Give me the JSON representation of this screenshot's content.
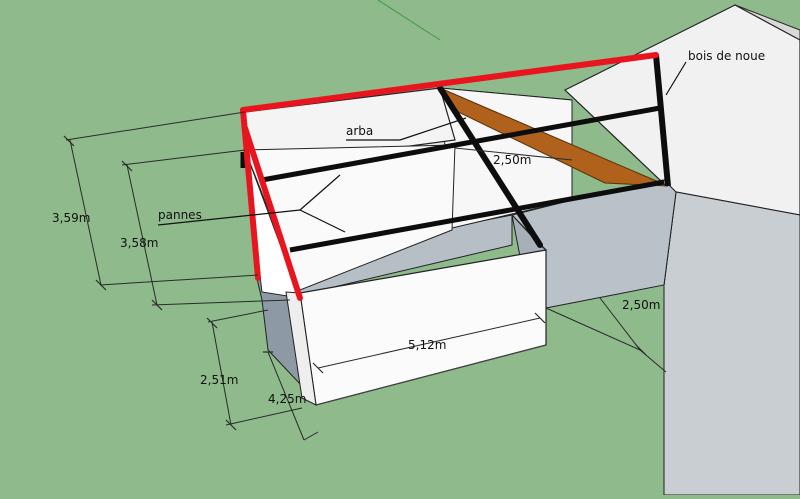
{
  "labels": {
    "bois_de_noue": "bois de noue",
    "arba": "arba",
    "pannes": "pannes"
  },
  "dimensions": {
    "h_359": "3,59m",
    "h_358": "3,58m",
    "h_251": "2,51m",
    "d_425": "4,25m",
    "w_512": "5,12m",
    "d_250_top": "2,50m",
    "d_250_right": "2,50m"
  },
  "colors": {
    "ground": "#8fba8c",
    "rafter_red": "#e8151f",
    "beam_black": "#0d0d0d",
    "arba_brown": "#b0621c",
    "roof_white": "#f4f4f4",
    "wall_white": "#fbfbfb",
    "wall_grey": "#b9c2c9"
  }
}
